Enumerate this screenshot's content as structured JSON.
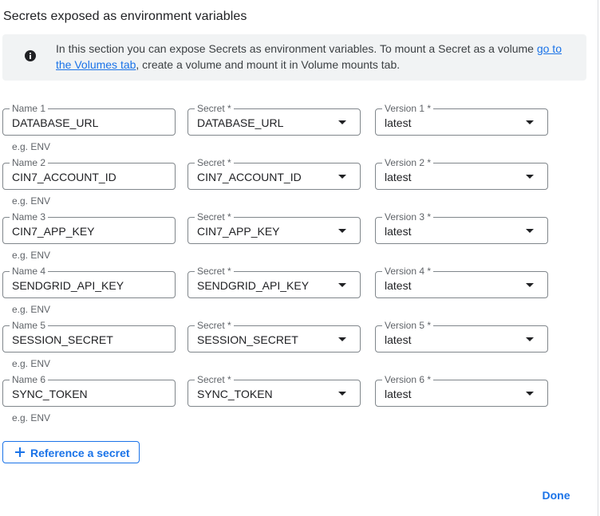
{
  "section": {
    "title": "Secrets exposed as environment variables"
  },
  "info": {
    "icon": "info-icon",
    "text_before": "In this section you can expose Secrets as environment variables. To mount a Secret as a volume ",
    "link_text": "go to the Volumes tab",
    "text_after": ", create a volume and mount it in Volume mounts tab."
  },
  "rows": [
    {
      "name_label": "Name 1",
      "name_value": "DATABASE_URL",
      "hint": "e.g. ENV",
      "secret_label": "Secret *",
      "secret_value": "DATABASE_URL",
      "version_label": "Version 1 *",
      "version_value": "latest"
    },
    {
      "name_label": "Name 2",
      "name_value": "CIN7_ACCOUNT_ID",
      "hint": "e.g. ENV",
      "secret_label": "Secret *",
      "secret_value": "CIN7_ACCOUNT_ID",
      "version_label": "Version 2 *",
      "version_value": "latest"
    },
    {
      "name_label": "Name 3",
      "name_value": "CIN7_APP_KEY",
      "hint": "e.g. ENV",
      "secret_label": "Secret *",
      "secret_value": "CIN7_APP_KEY",
      "version_label": "Version 3 *",
      "version_value": "latest"
    },
    {
      "name_label": "Name 4",
      "name_value": "SENDGRID_API_KEY",
      "hint": "e.g. ENV",
      "secret_label": "Secret *",
      "secret_value": "SENDGRID_API_KEY",
      "version_label": "Version 4 *",
      "version_value": "latest"
    },
    {
      "name_label": "Name 5",
      "name_value": "SESSION_SECRET",
      "hint": "e.g. ENV",
      "secret_label": "Secret *",
      "secret_value": "SESSION_SECRET",
      "version_label": "Version 5 *",
      "version_value": "latest"
    },
    {
      "name_label": "Name 6",
      "name_value": "SYNC_TOKEN",
      "hint": "e.g. ENV",
      "secret_label": "Secret *",
      "secret_value": "SYNC_TOKEN",
      "version_label": "Version 6 *",
      "version_value": "latest"
    }
  ],
  "actions": {
    "reference_label": "Reference a secret",
    "reference_icon": "plus-icon",
    "done_label": "Done"
  },
  "colors": {
    "accent": "#1a73e8",
    "info_bg": "#f1f3f4",
    "border": "#80868b",
    "muted_text": "#5f6368"
  }
}
